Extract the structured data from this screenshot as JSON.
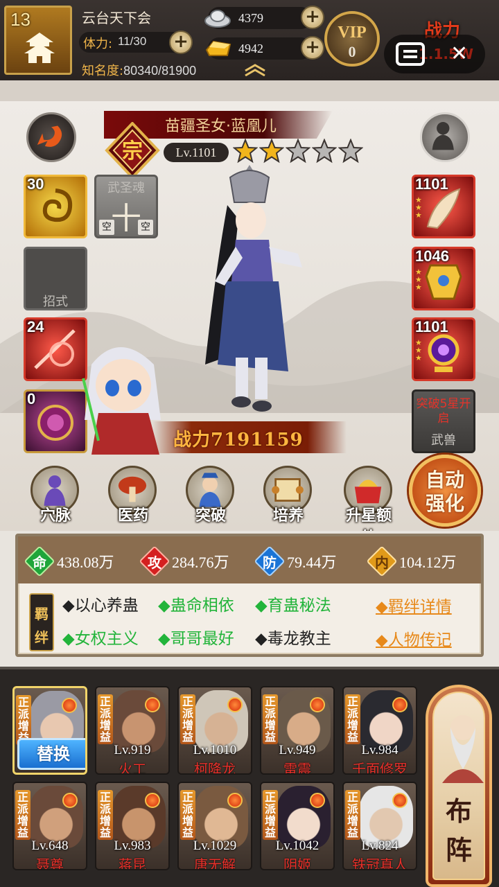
{
  "player": {
    "level": "13",
    "name": "云台天下会",
    "stamina_label": "体力:",
    "stamina_value": "11/30",
    "fame_label": "知名度:",
    "fame_value": "80340/81900",
    "silver": "4379",
    "gold": "4942",
    "vip_label": "VIP",
    "vip_level": "0",
    "power_label": "战力",
    "power_value": "1.1.5W"
  },
  "hero": {
    "name": "苗疆圣女·蓝凰儿",
    "level": "Lv.1101",
    "rank_char": "宗",
    "stars_filled": 2,
    "stars_total": 5,
    "power": "战力7191159",
    "left_slots": [
      {
        "count": "30",
        "label": ""
      },
      {
        "count": "",
        "label": "武圣魂",
        "big": "十",
        "kong1": "空",
        "kong2": "空"
      },
      {
        "count": "",
        "label": "招式"
      },
      {
        "count": "24",
        "label": ""
      },
      {
        "count": "0",
        "label": ""
      }
    ],
    "right_slots": [
      {
        "count": "1101"
      },
      {
        "count": "1046"
      },
      {
        "count": "1101"
      },
      {
        "top": "突破5星开启",
        "bottom": "武兽"
      }
    ]
  },
  "actions": [
    {
      "label": "穴脉"
    },
    {
      "label": "医药"
    },
    {
      "label": "突破"
    },
    {
      "label": "培养"
    },
    {
      "label": "升星额外"
    }
  ],
  "auto_button": {
    "line1": "自动",
    "line2": "强化"
  },
  "stats": [
    {
      "char": "命",
      "value": "438.08万",
      "color": "#1fa53a"
    },
    {
      "char": "攻",
      "value": "284.76万",
      "color": "#d42020"
    },
    {
      "char": "防",
      "value": "79.44万",
      "color": "#1a74d6"
    },
    {
      "char": "内",
      "value": "104.12万",
      "color": "#e09a1a"
    }
  ],
  "bonds": {
    "tag_1": "羁",
    "tag_2": "绊",
    "row1": [
      "◆以心养蛊",
      "◆蛊命相依",
      "◆育蛊秘法"
    ],
    "row2": [
      "◆女权主义",
      "◆哥哥最好",
      "◆毒龙教主"
    ],
    "detail_link": "◆羁绊详情",
    "bio_link": "◆人物传记"
  },
  "team": {
    "swap_label": "替换",
    "tag_text": "正派增益",
    "members": [
      {
        "level": "",
        "name": ""
      },
      {
        "level": "Lv.919",
        "name": "火工"
      },
      {
        "level": "Lv.1010",
        "name": "柯降龙"
      },
      {
        "level": "Lv.949",
        "name": "雷震"
      },
      {
        "level": "Lv.984",
        "name": "千面修罗"
      },
      {
        "level": "Lv.648",
        "name": "聂尊"
      },
      {
        "level": "Lv.983",
        "name": "蒋昆"
      },
      {
        "level": "Lv.1029",
        "name": "唐无解"
      },
      {
        "level": "Lv.1042",
        "name": "阴姬"
      },
      {
        "level": "Lv.824",
        "name": "铁冠真人"
      }
    ],
    "formation_1": "布",
    "formation_2": "阵"
  }
}
